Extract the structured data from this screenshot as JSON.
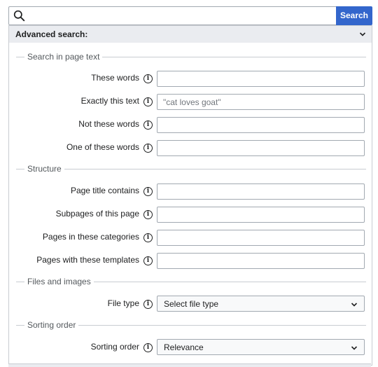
{
  "search": {
    "value": "",
    "placeholder": "",
    "button_label": "Search",
    "icon": "search-icon"
  },
  "advanced": {
    "title": "Advanced search:",
    "toggle_icon": "chevron-down-icon"
  },
  "sections": {
    "page_text": {
      "legend": "Search in page text",
      "fields": [
        {
          "label": "These words",
          "value": "",
          "placeholder": ""
        },
        {
          "label": "Exactly this text",
          "value": "",
          "placeholder": "\"cat loves goat\""
        },
        {
          "label": "Not these words",
          "value": "",
          "placeholder": ""
        },
        {
          "label": "One of these words",
          "value": "",
          "placeholder": ""
        }
      ]
    },
    "structure": {
      "legend": "Structure",
      "fields": [
        {
          "label": "Page title contains",
          "value": ""
        },
        {
          "label": "Subpages of this page",
          "value": ""
        },
        {
          "label": "Pages in these categories",
          "value": ""
        },
        {
          "label": "Pages with these templates",
          "value": ""
        }
      ]
    },
    "files": {
      "legend": "Files and images",
      "file_type": {
        "label": "File type",
        "selected": "Select file type"
      }
    },
    "sorting": {
      "legend": "Sorting order",
      "order": {
        "label": "Sorting order",
        "selected": "Relevance"
      }
    }
  },
  "info_glyph": "i",
  "colors": {
    "accent": "#3366cc",
    "border": "#a2a9b1",
    "header_bg": "#eaecf0"
  }
}
